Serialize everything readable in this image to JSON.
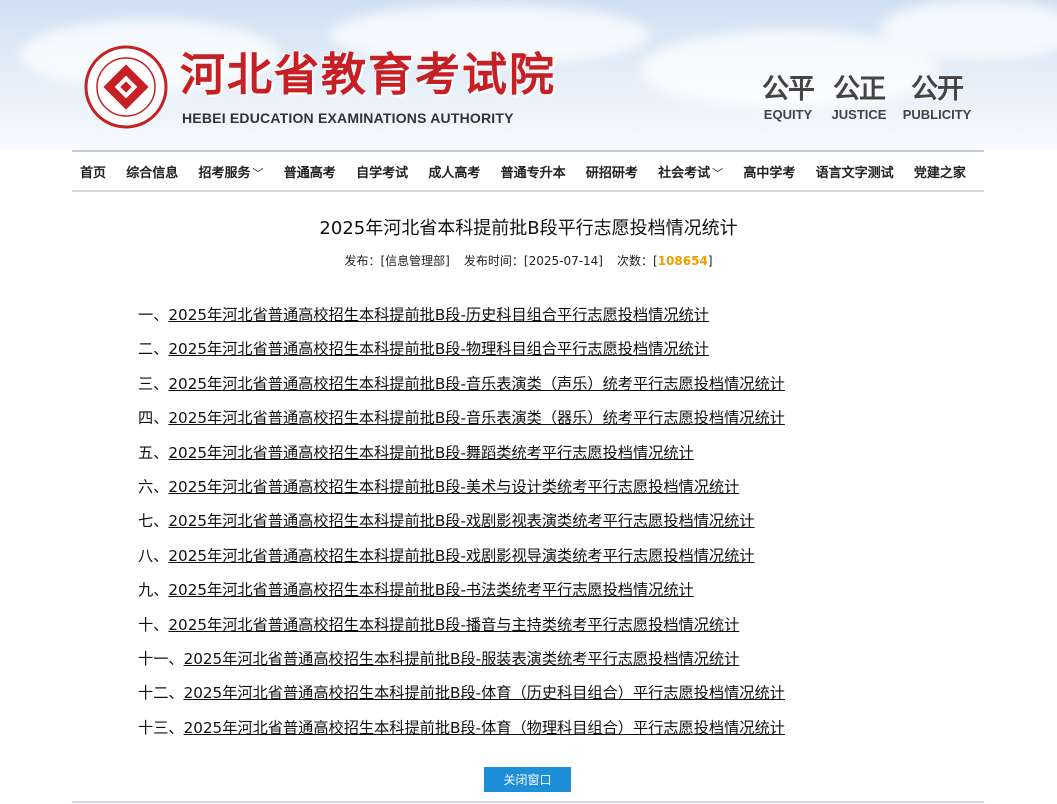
{
  "header": {
    "site_title": "河北省教育考试院",
    "site_subtitle": "HEBEI EDUCATION EXAMINATIONS AUTHORITY",
    "seal_ring_text": "河北省教育考试院 HEBEI EDUCATION EXAMINATIONS AUTHORITY",
    "motto": [
      {
        "cn": "公平",
        "en": "EQUITY"
      },
      {
        "cn": "公正",
        "en": "JUSTICE"
      },
      {
        "cn": "公开",
        "en": "PUBLICITY"
      }
    ],
    "brand_color": "#c62024"
  },
  "nav": {
    "items": [
      {
        "label": "首页"
      },
      {
        "label": "综合信息"
      },
      {
        "label": "招考服务",
        "dropdown": "﹀"
      },
      {
        "label": "普通高考"
      },
      {
        "label": "自学考试"
      },
      {
        "label": "成人高考"
      },
      {
        "label": "普通专升本"
      },
      {
        "label": "研招研考"
      },
      {
        "label": "社会考试",
        "dropdown": "﹀"
      },
      {
        "label": "高中学考"
      },
      {
        "label": "语言文字测试"
      },
      {
        "label": "党建之家"
      }
    ]
  },
  "article": {
    "title": "2025年河北省本科提前批B段平行志愿投档情况统计",
    "meta": {
      "publisher_label": "发布：",
      "publisher": "[信息管理部]",
      "date_label": "发布时间：",
      "date": "[2025-07-14]",
      "views_label": "次数：",
      "views_open": "[",
      "views": "108654",
      "views_close": "]",
      "views_color": "#f39a00"
    },
    "links": [
      {
        "prefix": "一、",
        "text": "2025年河北省普通高校招生本科提前批B段-历史科目组合平行志愿投档情况统计"
      },
      {
        "prefix": "二、",
        "text": "2025年河北省普通高校招生本科提前批B段-物理科目组合平行志愿投档情况统计"
      },
      {
        "prefix": "三、",
        "text": "2025年河北省普通高校招生本科提前批B段-音乐表演类（声乐）统考平行志愿投档情况统计"
      },
      {
        "prefix": "四、",
        "text": "2025年河北省普通高校招生本科提前批B段-音乐表演类（器乐）统考平行志愿投档情况统计"
      },
      {
        "prefix": "五、",
        "text": "2025年河北省普通高校招生本科提前批B段-舞蹈类统考平行志愿投档情况统计"
      },
      {
        "prefix": "六、",
        "text": "2025年河北省普通高校招生本科提前批B段-美术与设计类统考平行志愿投档情况统计"
      },
      {
        "prefix": "七、",
        "text": "2025年河北省普通高校招生本科提前批B段-戏剧影视表演类统考平行志愿投档情况统计"
      },
      {
        "prefix": "八、",
        "text": "2025年河北省普通高校招生本科提前批B段-戏剧影视导演类统考平行志愿投档情况统计"
      },
      {
        "prefix": "九、",
        "text": "2025年河北省普通高校招生本科提前批B段-书法类统考平行志愿投档情况统计"
      },
      {
        "prefix": "十、",
        "text": "2025年河北省普通高校招生本科提前批B段-播音与主持类统考平行志愿投档情况统计"
      },
      {
        "prefix": "十一、",
        "text": "2025年河北省普通高校招生本科提前批B段-服装表演类统考平行志愿投档情况统计"
      },
      {
        "prefix": "十二、",
        "text": "2025年河北省普通高校招生本科提前批B段-体育（历史科目组合）平行志愿投档情况统计"
      },
      {
        "prefix": "十三、",
        "text": "2025年河北省普通高校招生本科提前批B段-体育（物理科目组合）平行志愿投档情况统计"
      }
    ]
  },
  "footer": {
    "close_button": "关闭窗口",
    "close_button_color": "#1d8fd8"
  }
}
